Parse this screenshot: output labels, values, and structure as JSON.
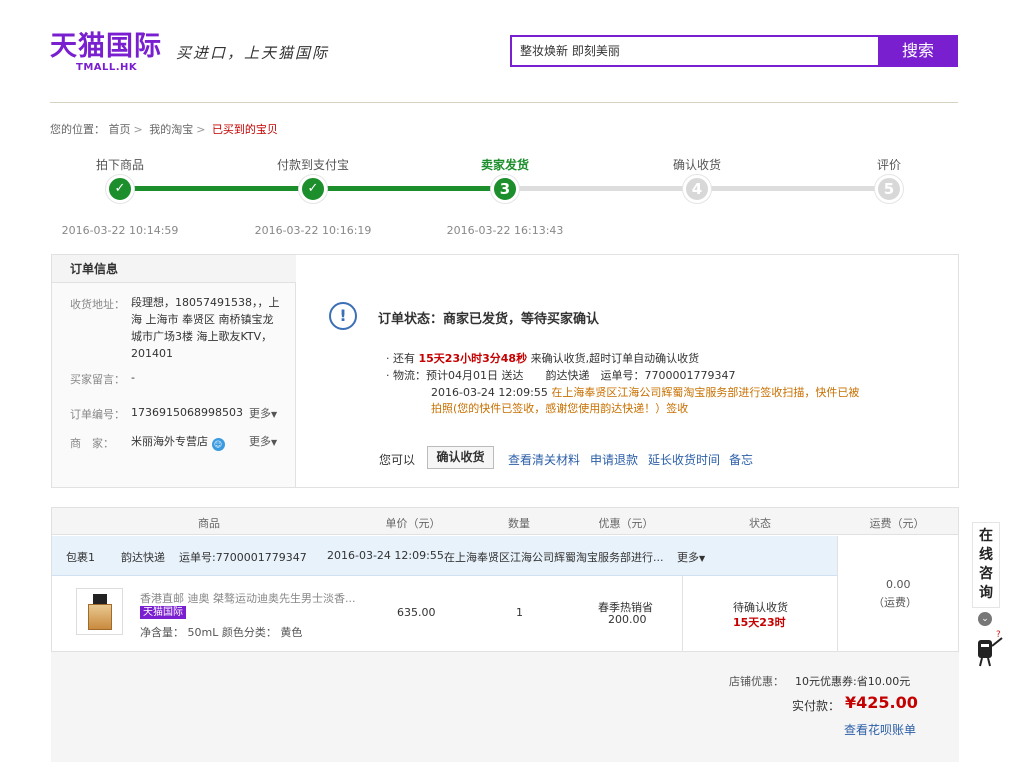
{
  "header": {
    "logo": "天猫国际",
    "logo_sub": "TMALL.HK",
    "slogan": "买进口，上天猫国际",
    "search_value": "整妆焕新 即刻美丽",
    "search_button": "搜索"
  },
  "breadcrumb": {
    "prefix": "您的位置：",
    "items": [
      "首页",
      "我的淘宝",
      "已买到的宝贝"
    ]
  },
  "progress": {
    "steps": [
      {
        "label": "拍下商品",
        "time": "2016-03-22 10:14:59",
        "mark": "✓"
      },
      {
        "label": "付款到支付宝",
        "time": "2016-03-22 10:16:19",
        "mark": "✓"
      },
      {
        "label": "卖家发货",
        "time": "2016-03-22 16:13:43",
        "mark": "3"
      },
      {
        "label": "确认收货",
        "time": "",
        "mark": "4"
      },
      {
        "label": "评价",
        "time": "",
        "mark": "5"
      }
    ],
    "current_step": 3
  },
  "order_info": {
    "title": "订单信息",
    "address_label": "收货地址：",
    "address": "段理想，18057491538，，上海 上海市 奉贤区 南桥镇宝龙城市广场3楼 海上歌友KTV，201401",
    "message_label": "买家留言：",
    "message": "-",
    "order_no_label": "订单编号：",
    "order_no": "1736915068998503",
    "seller_label": "商　家：",
    "seller": "米丽海外专营店",
    "more": "更多"
  },
  "status": {
    "title": "订单状态：商家已发货，等待买家确认",
    "remaining_prefix": "· 还有 ",
    "remaining": "15天23小时3分48秒",
    "remaining_suffix": " 来确认收货,超时订单自动确认收货",
    "logistics_label": "· 物流：",
    "logistics": "预计04月01日 送达　　韵达快递　运单号：7700001779347",
    "tracking_time": "2016-03-24 12:09:55",
    "tracking_line1": "在上海奉贤区江海公司辉蜀淘宝服务部进行签收扫描，快件已被",
    "tracking_line2": "拍照(您的快件已签收，感谢您使用韵达快递！）签收"
  },
  "actions": {
    "prefix": "您可以",
    "confirm": "确认收货",
    "links": [
      "查看清关材料",
      "申请退款",
      "延长收货时间",
      "备忘"
    ]
  },
  "goods": {
    "headers": [
      "商品",
      "单价（元）",
      "数量",
      "优惠（元）",
      "状态",
      "运费（元）"
    ],
    "package": {
      "name": "包裹1",
      "courier": "韵达快递",
      "waybill": "运单号:7700001779347",
      "time": "2016-03-24 12:09:55",
      "desc": "在上海奉贤区江海公司辉蜀淘宝服务部进行...",
      "more": "更多"
    },
    "item": {
      "title": "香港直邮 迪奥 桀骜运动迪奥先生男士淡香...",
      "badge": "天猫国际",
      "spec": "净含量：  50mL  颜色分类：  黄色",
      "price": "635.00",
      "qty": "1",
      "promo_name": "春季热销省",
      "promo_value": "200.00",
      "status": "待确认收货",
      "status_time": "15天23时"
    },
    "shipping": "0.00",
    "shipping_note": "（运费）"
  },
  "summary": {
    "shop_discount_label": "店铺优惠：",
    "shop_discount": "10元优惠券:省10.00元",
    "total_label": "实付款：",
    "total": "¥425.00",
    "bill_link": "查看花呗账单"
  },
  "side": {
    "chat": "在线咨询"
  },
  "colors": {
    "brand": "#7a1fd0",
    "progress": "#1c8f2c",
    "price_red": "#c40000",
    "link": "#2c5fa8"
  }
}
